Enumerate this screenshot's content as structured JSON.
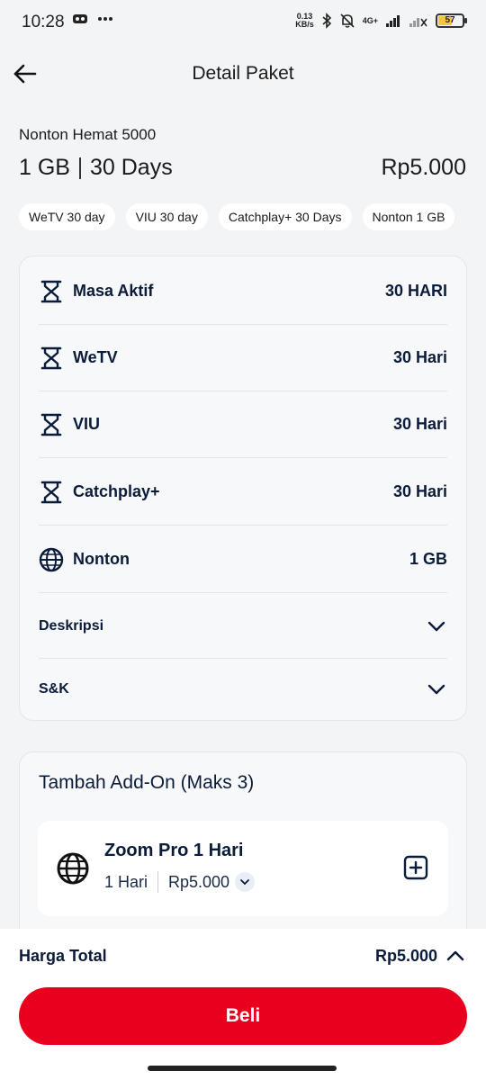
{
  "status_bar": {
    "time": "10:28",
    "net_speed_value": "0.13",
    "net_speed_unit": "KB/s",
    "network": "4G+",
    "battery": "57"
  },
  "header": {
    "title": "Detail Paket"
  },
  "package": {
    "name": "Nonton Hemat 5000",
    "quota": "1 GB",
    "duration": "30 Days",
    "price": "Rp5.000",
    "chips": [
      "WeTV 30 day",
      "VIU 30 day",
      "Catchplay+ 30 Days",
      "Nonton 1 GB"
    ]
  },
  "details": {
    "rows": [
      {
        "label": "Masa Aktif",
        "value": "30 HARI",
        "icon": "hourglass-icon"
      },
      {
        "label": "WeTV",
        "value": "30 Hari",
        "icon": "hourglass-icon"
      },
      {
        "label": "VIU",
        "value": "30 Hari",
        "icon": "hourglass-icon"
      },
      {
        "label": "Catchplay+",
        "value": "30 Hari",
        "icon": "hourglass-icon"
      },
      {
        "label": "Nonton",
        "value": "1 GB",
        "icon": "globe-icon"
      }
    ],
    "description_label": "Deskripsi",
    "terms_label": "S&K"
  },
  "addon": {
    "title": "Tambah Add-On (Maks 3)",
    "item": {
      "name": "Zoom Pro 1 Hari",
      "duration": "1 Hari",
      "price": "Rp5.000",
      "icon": "globe-icon"
    }
  },
  "footer": {
    "total_label": "Harga Total",
    "total_value": "Rp5.000",
    "buy_label": "Beli"
  },
  "colors": {
    "accent": "#e8001e",
    "text_primary": "#0b1b3a",
    "background": "#f3f4f6"
  }
}
